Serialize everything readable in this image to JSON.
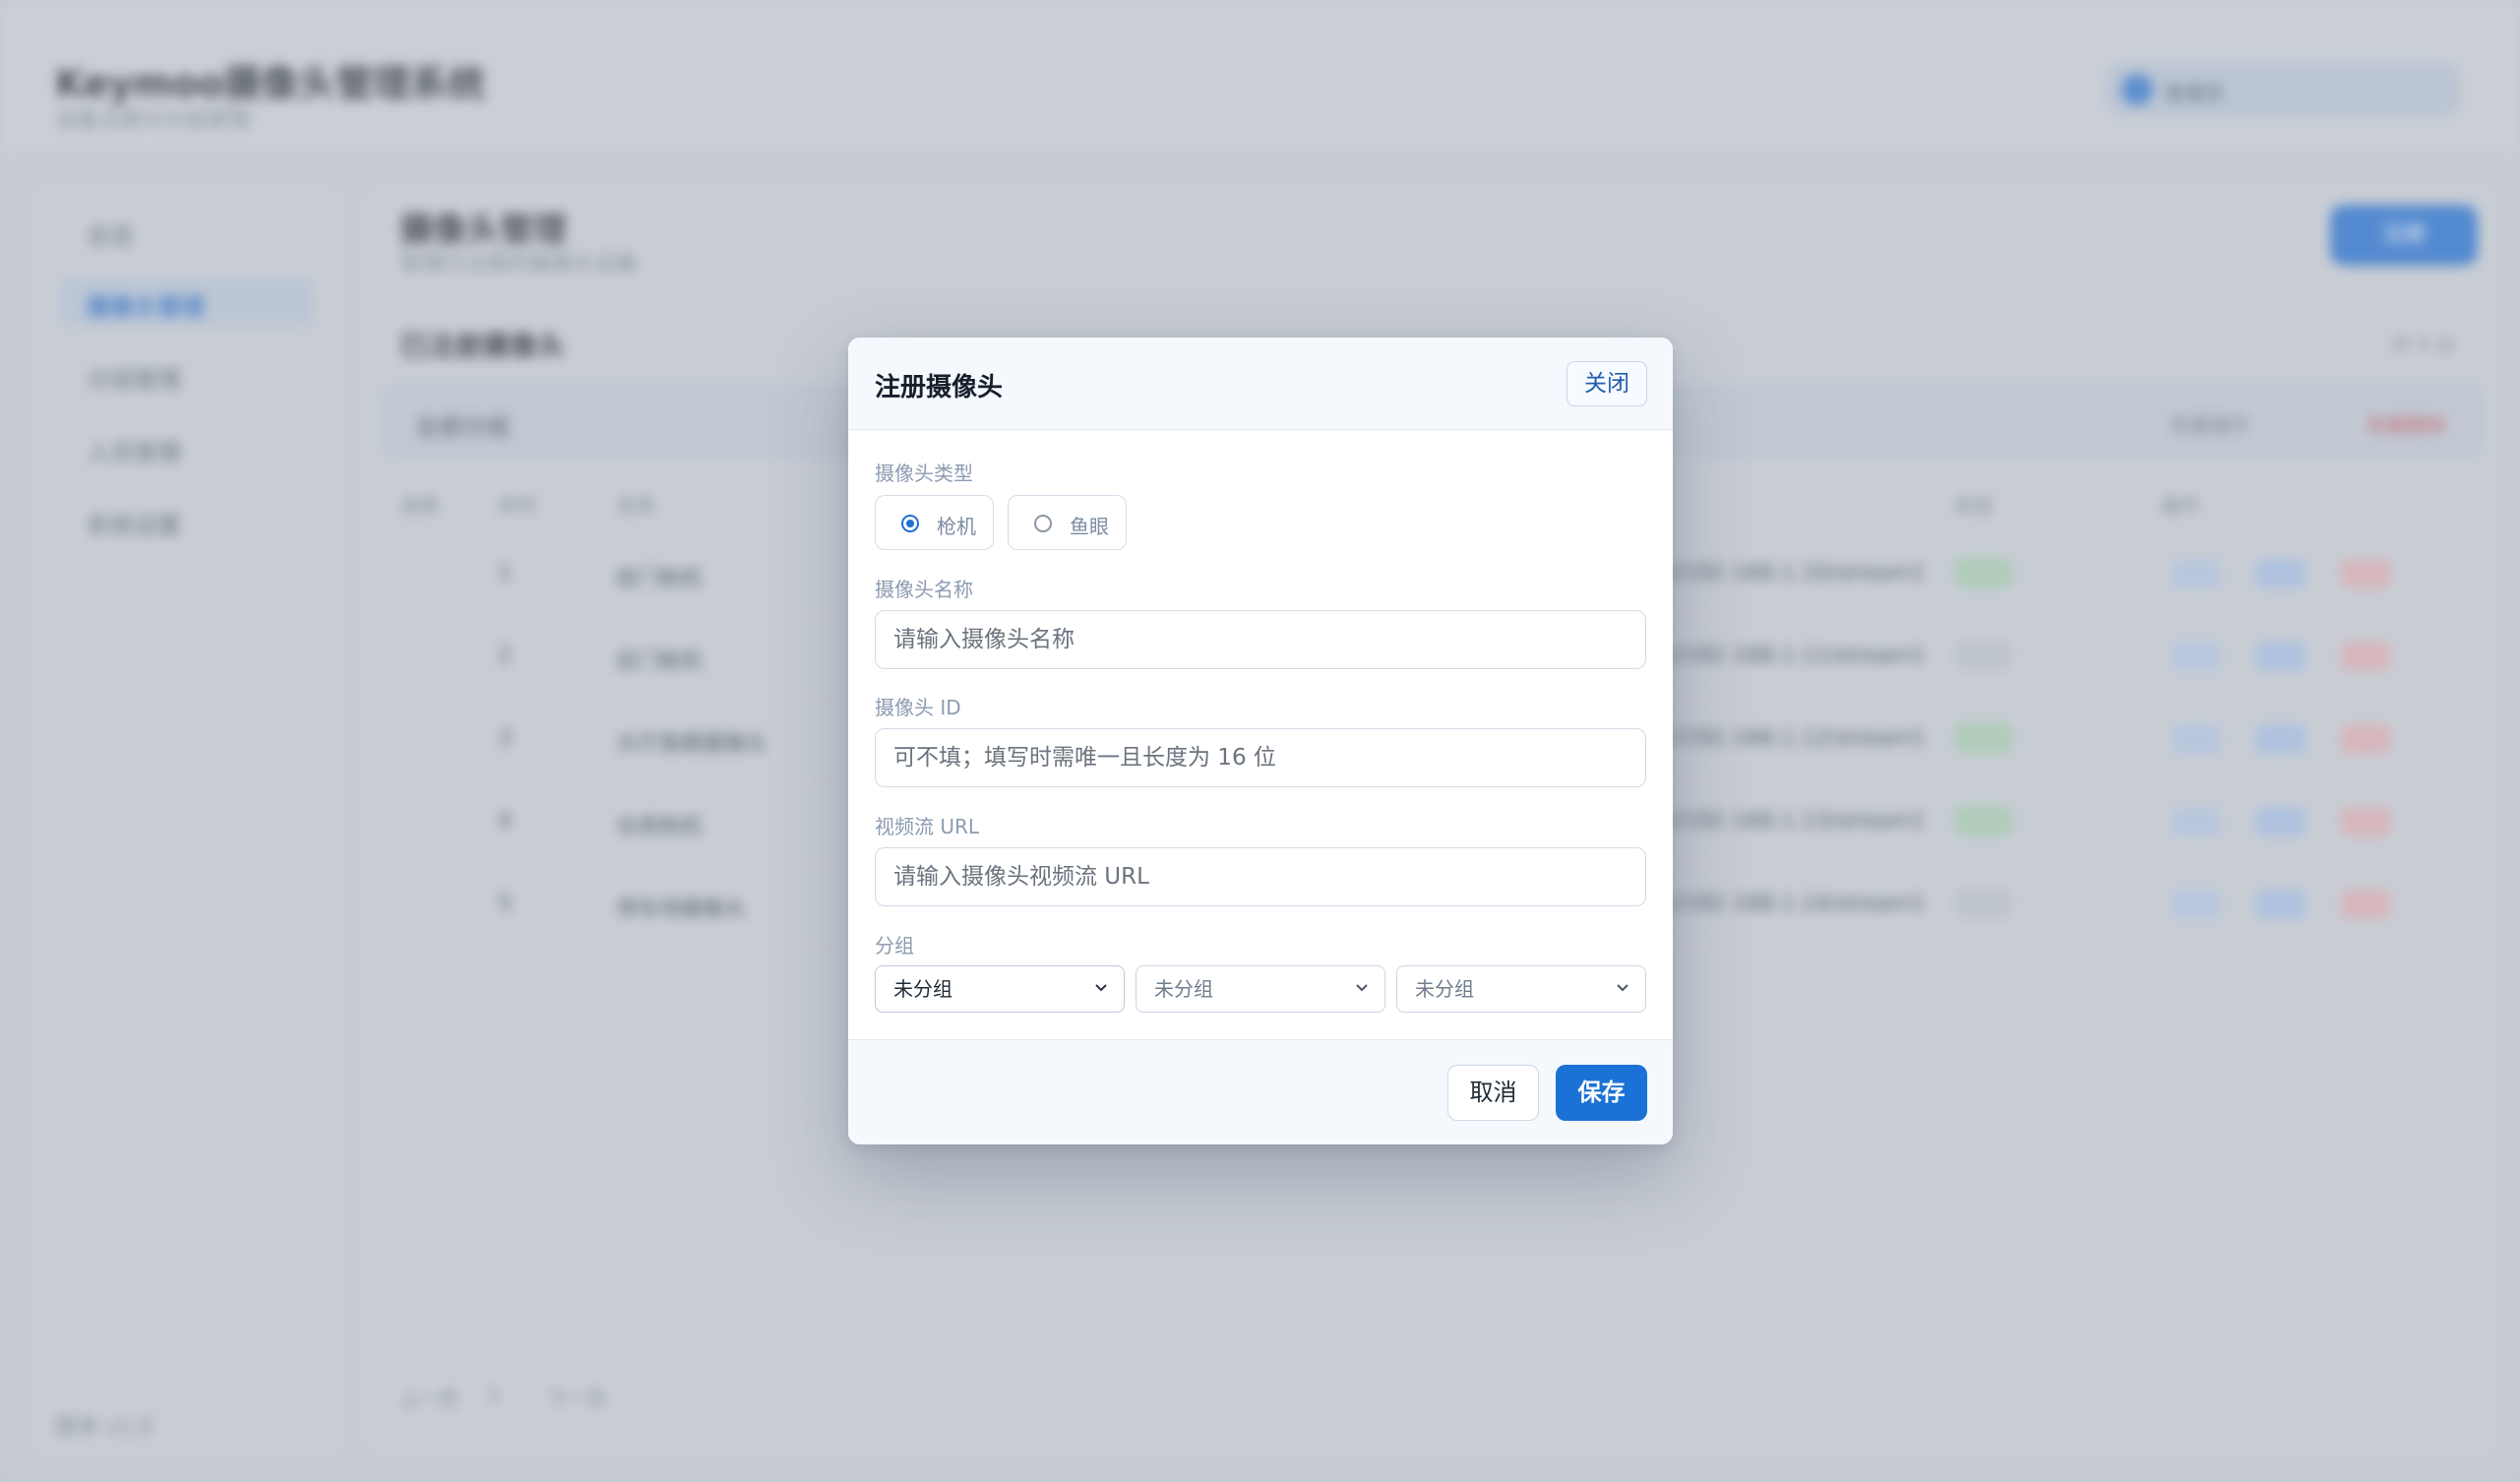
{
  "background": {
    "app_title": "Keymoo摄像头管理系统",
    "app_subtitle": "设备注册与分组管理",
    "user_chip": "管理员",
    "sidebar": [
      "总览",
      "摄像头管理",
      "分组管理",
      "人员管理",
      "系统设置"
    ],
    "version": "版本 v1.0",
    "main_title": "摄像头管理",
    "main_subtitle": "管理已注册的摄像头设备",
    "add_button": "注册",
    "list_title": "已注册摄像头",
    "list_count": "共 5 台",
    "toolbar_text": "全部分组",
    "toolbar_right": "批量操作",
    "toolbar_danger": "批量删除",
    "table_headers": [
      "选择",
      "序号",
      "名称",
      "状态",
      "操作"
    ],
    "rows": [
      {
        "index": "1",
        "name": "前门枪机",
        "url": "rtsp://192.168.1.10/stream1",
        "status": "在线"
      },
      {
        "index": "2",
        "name": "后门枪机",
        "url": "rtsp://192.168.1.11/stream1",
        "status": "离线"
      },
      {
        "index": "3",
        "name": "大厅鱼眼摄像头",
        "url": "rtsp://192.168.1.12/stream1",
        "status": "在线"
      },
      {
        "index": "4",
        "name": "仓库枪机",
        "url": "rtsp://192.168.1.13/stream1",
        "status": "在线"
      },
      {
        "index": "5",
        "name": "停车场摄像头",
        "url": "rtsp://192.168.1.14/stream1",
        "status": "离线"
      }
    ],
    "row_actions": [
      "查看",
      "编辑",
      "删除"
    ],
    "footer_left": [
      "上一页",
      "1",
      "下一页"
    ]
  },
  "modal": {
    "title": "注册摄像头",
    "close_label": "关闭",
    "type_label": "摄像头类型",
    "type_options": [
      {
        "label": "枪机",
        "checked": true
      },
      {
        "label": "鱼眼",
        "checked": false
      }
    ],
    "name_label": "摄像头名称",
    "name_placeholder": "请输入摄像头名称",
    "id_label": "摄像头 ID",
    "id_placeholder": "可不填；填写时需唯一且长度为 16 位",
    "url_label": "视频流 URL",
    "url_placeholder": "请输入摄像头视频流 URL",
    "group_label": "分组",
    "group_selects": [
      {
        "value": "未分组",
        "enabled": true
      },
      {
        "value": "未分组",
        "enabled": false
      },
      {
        "value": "未分组",
        "enabled": false
      }
    ],
    "cancel_label": "取消",
    "save_label": "保存"
  },
  "colors": {
    "accent": "#1a72d6",
    "label": "#8c9bb0",
    "title": "#16202b"
  }
}
